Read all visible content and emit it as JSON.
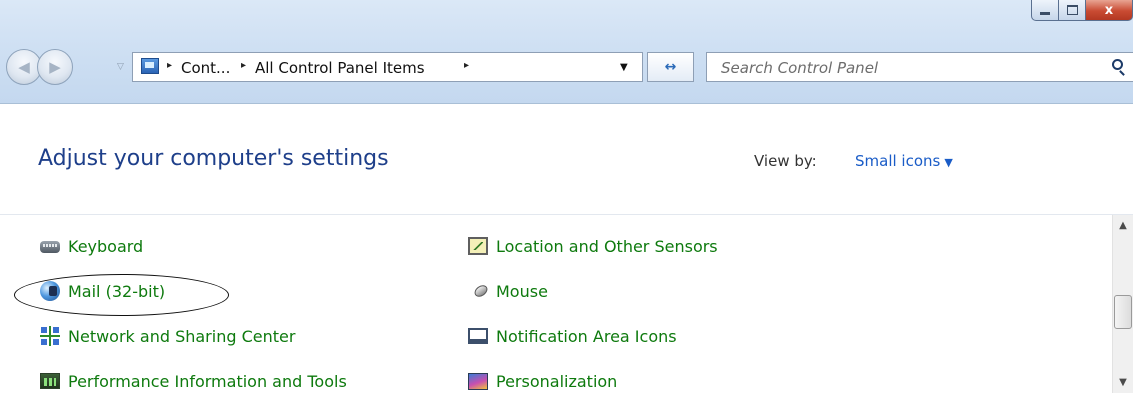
{
  "window": {
    "minimize_icon": "minimize-icon",
    "maximize_icon": "maximize-icon",
    "close_glyph": "x"
  },
  "nav": {
    "back_glyph": "◀",
    "forward_glyph": "▶",
    "history_glyph": "▽"
  },
  "address": {
    "separator": "▸",
    "crumbs": [
      "Cont...",
      "All Control Panel Items"
    ],
    "dropdown_glyph": "▼"
  },
  "refresh": {
    "glyph": "↔"
  },
  "search": {
    "placeholder": "Search Control Panel"
  },
  "header": {
    "title": "Adjust your computer's settings",
    "view_by_label": "View by:",
    "view_by_value": "Small icons",
    "view_by_arrow": "▼"
  },
  "items": [
    {
      "label": "Keyboard",
      "icon": "keyboard-icon"
    },
    {
      "label": "Mail (32-bit)",
      "icon": "mail-icon"
    },
    {
      "label": "Network and Sharing Center",
      "icon": "network-icon"
    },
    {
      "label": "Performance Information and Tools",
      "icon": "performance-icon"
    },
    {
      "label": "Location and Other Sensors",
      "icon": "sensors-icon"
    },
    {
      "label": "Mouse",
      "icon": "mouse-icon"
    },
    {
      "label": "Notification Area Icons",
      "icon": "notification-icon"
    },
    {
      "label": "Personalization",
      "icon": "personalization-icon"
    }
  ],
  "scrollbar": {
    "up_glyph": "▲",
    "down_glyph": "▼"
  },
  "colors": {
    "link_green": "#0e7a0e",
    "title_blue": "#1e3f8a",
    "view_by_blue": "#1a5cc7",
    "close_red": "#c94b33"
  }
}
